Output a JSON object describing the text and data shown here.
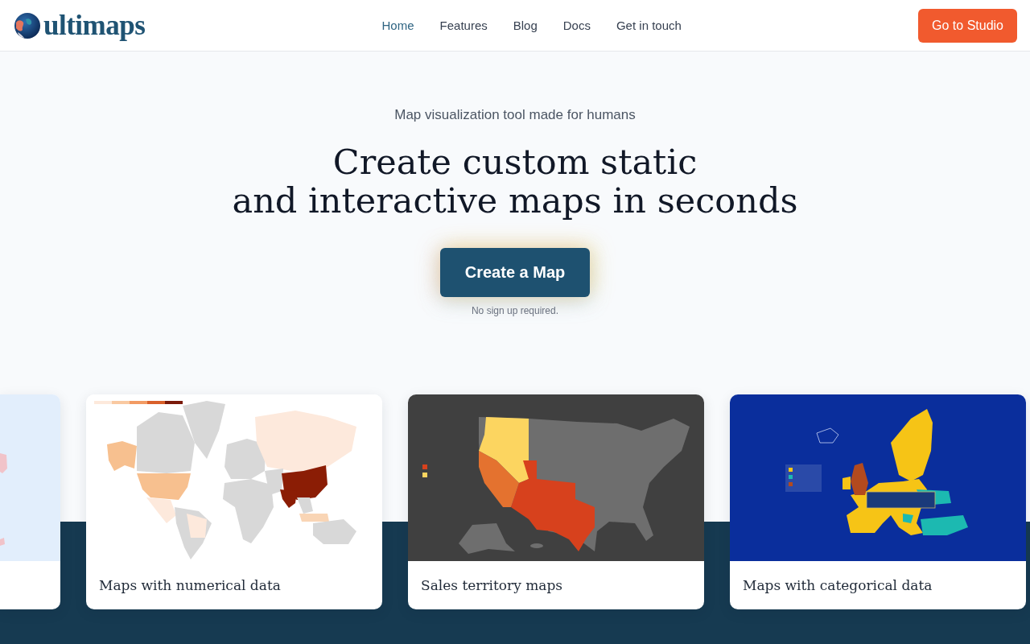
{
  "header": {
    "logo": "ultimaps",
    "nav": [
      {
        "label": "Home",
        "selected": true
      },
      {
        "label": "Features",
        "selected": false
      },
      {
        "label": "Blog",
        "selected": false
      },
      {
        "label": "Docs",
        "selected": false
      },
      {
        "label": "Get in touch",
        "selected": false
      }
    ],
    "cta": "Go to Studio"
  },
  "hero": {
    "tagline": "Map visualization tool made for humans",
    "headline": [
      "Create custom static",
      "and interactive maps in seconds"
    ],
    "button": "Create a Map",
    "note": "No sign up required."
  },
  "showcase": {
    "cards": [
      {
        "kind": "partial"
      },
      {
        "kind": "world",
        "caption": "Maps with numerical data"
      },
      {
        "kind": "usa",
        "caption": "Sales territory maps"
      },
      {
        "kind": "europe",
        "caption": "Maps with categorical data"
      }
    ]
  }
}
